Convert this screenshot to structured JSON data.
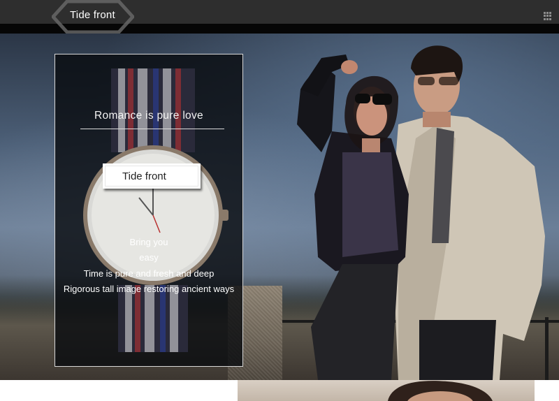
{
  "header": {
    "brand": "Tide front",
    "menu_icon": "grid-icon"
  },
  "hero": {
    "image": "couple-photo",
    "panel": {
      "background_image": "wristwatch-image",
      "title": "Romance is pure love",
      "button_label": "Tide front",
      "lines": [
        "Bring you",
        "easy",
        "Time is pure and fresh and deep",
        "Rigorous tall image restoring ancient ways"
      ]
    }
  },
  "thumbnail": {
    "image": "portrait-thumbnail"
  },
  "colors": {
    "header_bg": "#2e2e2e",
    "panel_border": "#d8d8d8",
    "button_bg": "#ffffff"
  }
}
